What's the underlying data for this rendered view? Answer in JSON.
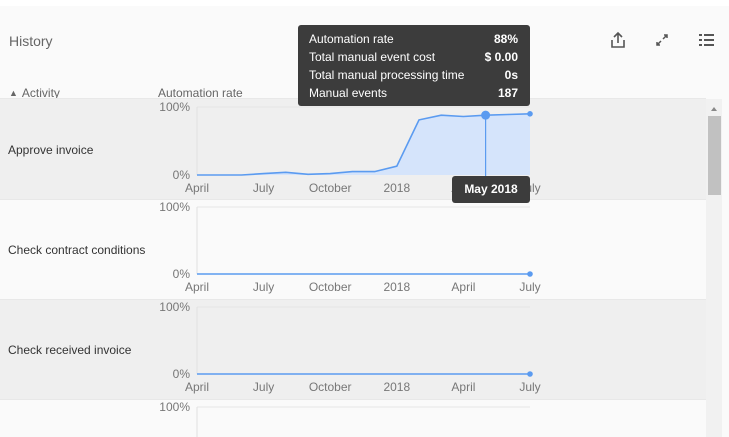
{
  "header": {
    "title": "History",
    "icons": [
      "share-icon",
      "expand-icon",
      "list-icon"
    ]
  },
  "columns": {
    "activity": "Activity",
    "rate": "Automation rate"
  },
  "rows": [
    {
      "label": "Approve invoice"
    },
    {
      "label": "Check contract conditions"
    },
    {
      "label": "Check received invoice"
    }
  ],
  "axis": {
    "x_ticks": [
      "April",
      "July",
      "October",
      "2018",
      "April",
      "July"
    ],
    "y_ticks": [
      "0%",
      "100%"
    ]
  },
  "tooltip": {
    "rows": [
      {
        "label": "Automation rate",
        "value": "88%"
      },
      {
        "label": "Total manual event cost",
        "value": "$ 0.00"
      },
      {
        "label": "Total manual processing time",
        "value": "0s"
      },
      {
        "label": "Manual events",
        "value": "187"
      }
    ],
    "x_label": "May 2018"
  },
  "colors": {
    "line": "#5b9bf0",
    "fill": "#d5e4fb",
    "tooltip_bg": "#3c3c3c"
  },
  "chart_data": [
    {
      "type": "area",
      "title": "Approve invoice",
      "x": [
        "Apr 2017",
        "May 2017",
        "Jun 2017",
        "Jul 2017",
        "Aug 2017",
        "Sep 2017",
        "Oct 2017",
        "Nov 2017",
        "Dec 2017",
        "Jan 2018",
        "Feb 2018",
        "Mar 2018",
        "Apr 2018",
        "May 2018",
        "Jun 2018",
        "Jul 2018"
      ],
      "values": [
        0,
        0,
        0,
        2,
        4,
        1,
        2,
        5,
        5,
        13,
        81,
        88,
        86,
        88,
        89,
        90
      ],
      "ylim": [
        0,
        100
      ],
      "highlight": "May 2018"
    },
    {
      "type": "line",
      "title": "Check contract conditions",
      "x": [
        "Apr 2017",
        "May 2017",
        "Jun 2017",
        "Jul 2017",
        "Aug 2017",
        "Sep 2017",
        "Oct 2017",
        "Nov 2017",
        "Dec 2017",
        "Jan 2018",
        "Feb 2018",
        "Mar 2018",
        "Apr 2018",
        "May 2018",
        "Jun 2018",
        "Jul 2018"
      ],
      "values": [
        0,
        0,
        0,
        0,
        0,
        0,
        0,
        0,
        0,
        0,
        0,
        0,
        0,
        0,
        0,
        0
      ],
      "ylim": [
        0,
        100
      ]
    },
    {
      "type": "line",
      "title": "Check received invoice",
      "x": [
        "Apr 2017",
        "May 2017",
        "Jun 2017",
        "Jul 2017",
        "Aug 2017",
        "Sep 2017",
        "Oct 2017",
        "Nov 2017",
        "Dec 2017",
        "Jan 2018",
        "Feb 2018",
        "Mar 2018",
        "Apr 2018",
        "May 2018",
        "Jun 2018",
        "Jul 2018"
      ],
      "values": [
        0,
        0,
        0,
        0,
        0,
        0,
        0,
        0,
        0,
        0,
        0,
        0,
        0,
        0,
        0,
        0
      ],
      "ylim": [
        0,
        100
      ]
    }
  ]
}
